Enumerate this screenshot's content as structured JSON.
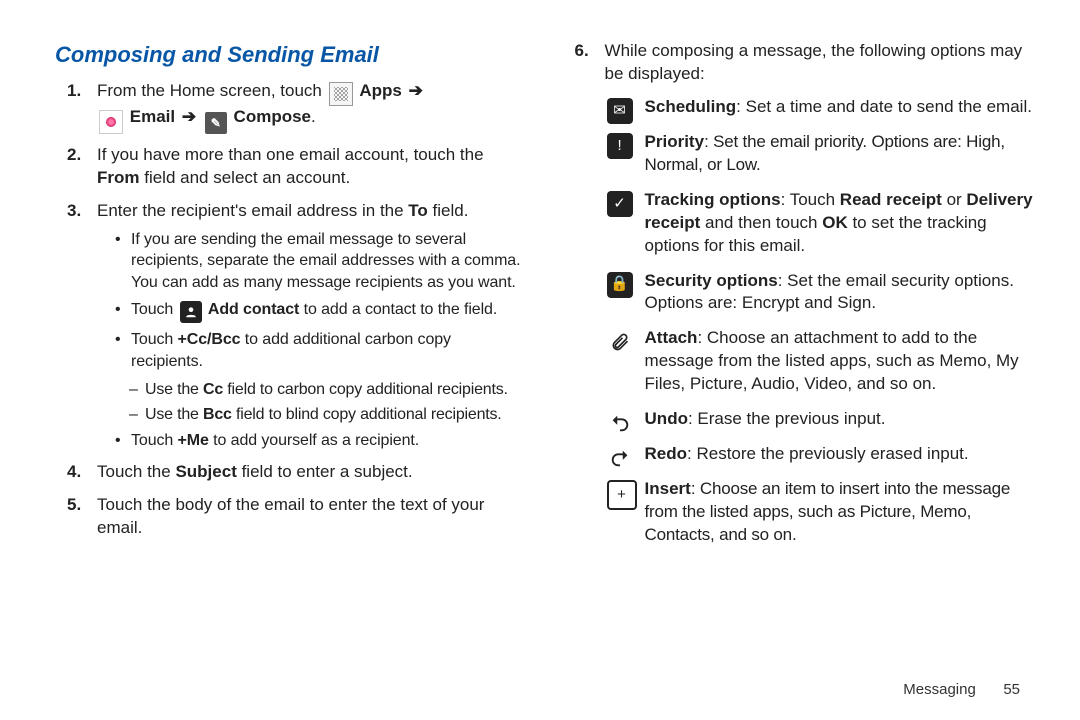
{
  "heading": "Composing and Sending Email",
  "col1": {
    "step1_a": "From the Home screen, touch ",
    "step1_apps": "Apps",
    "step1_email": "Email",
    "step1_compose": "Compose",
    "arrow": "➔",
    "step2_a": "If you have more than one email account, touch the ",
    "step2_b": "From",
    "step2_c": " field and select an account.",
    "step3_a": "Enter the recipient's email address in the ",
    "step3_b": "To",
    "step3_c": " field.",
    "s3_bul1": "If you are sending the email message to several recipients, separate the email addresses with a comma. You can add as many message recipients as you want.",
    "s3_bul2_a": "Touch ",
    "s3_bul2_b": "Add contact",
    "s3_bul2_c": " to add a contact to the field.",
    "s3_bul3_a": "Touch ",
    "s3_bul3_b": "+Cc/Bcc",
    "s3_bul3_c": " to add additional carbon copy recipients.",
    "s3_d1_a": "Use the ",
    "s3_d1_b": "Cc",
    "s3_d1_c": " field to carbon copy additional recipients.",
    "s3_d2_a": "Use the ",
    "s3_d2_b": "Bcc",
    "s3_d2_c": " field to blind copy additional recipients.",
    "s3_bul4_a": "Touch ",
    "s3_bul4_b": "+Me",
    "s3_bul4_c": " to add yourself as a recipient.",
    "step4_a": "Touch the ",
    "step4_b": "Subject",
    "step4_c": " field to enter a subject.",
    "step5": "Touch the body of the email to enter the text of your email."
  },
  "col2": {
    "step6": "While composing a message, the following options may be displayed:",
    "feat": [
      {
        "title": "Scheduling",
        "text": ": Set a time and date to send the email."
      },
      {
        "title": "Priority",
        "text": ": Set the email priority. Options are: High, Normal, or Low."
      },
      {
        "title": "Tracking options",
        "text_a": ": Touch ",
        "text_b": "Read receipt",
        "text_c": " or ",
        "text_d": "Delivery receipt",
        "text_e": " and then touch ",
        "text_f": "OK",
        "text_g": " to set the tracking options for this email."
      },
      {
        "title": "Security options",
        "text": ": Set the email security options. Options are: Encrypt and Sign."
      },
      {
        "title": "Attach",
        "text": ": Choose an attachment to add to the message from the listed apps, such as Memo, My Files, Picture, Audio, Video, and so on."
      },
      {
        "title": "Undo",
        "text": ": Erase the previous input."
      },
      {
        "title": "Redo",
        "text": ": Restore the previously erased input."
      },
      {
        "title": "Insert",
        "text": ": Choose an item to insert into the message from the listed apps, such as Picture, Memo, Contacts, and so on."
      }
    ]
  },
  "footer": {
    "section": "Messaging",
    "page": "55"
  }
}
